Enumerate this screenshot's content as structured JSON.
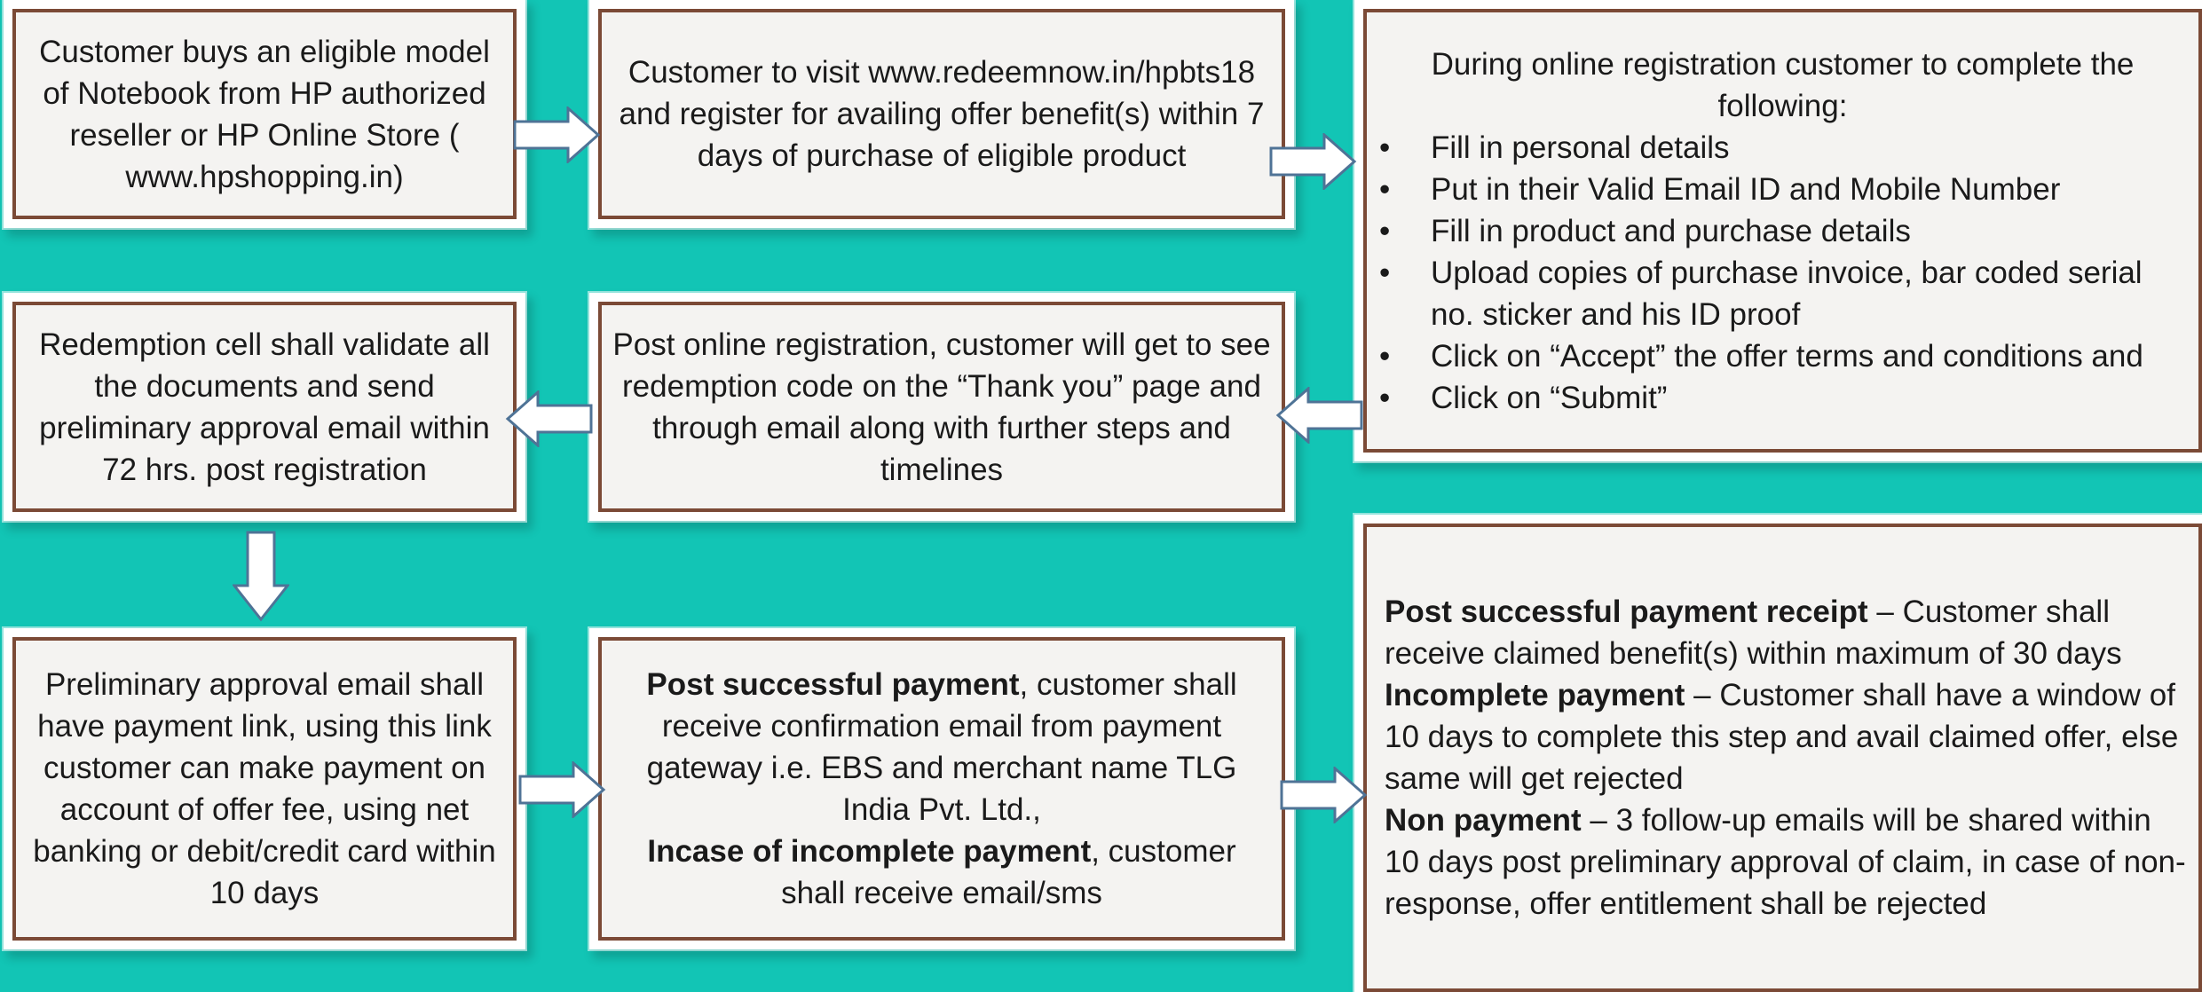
{
  "boxes": {
    "b1": "Customer buys an eligible model of Notebook from HP authorized reseller or HP Online Store ( www.hpshopping.in)",
    "b2": "Customer to visit www.redeemnow.in/hpbts18 and register for availing offer benefit(s) within 7 days of purchase of eligible product",
    "b3": {
      "heading": "During online registration customer  to complete the following:",
      "items": [
        "Fill in personal details",
        "Put in their Valid Email ID and Mobile Number",
        "Fill in product and purchase details",
        "Upload copies of purchase invoice, bar coded serial no. sticker and his ID proof",
        "Click on “Accept” the offer terms and conditions and",
        "Click on “Submit”"
      ]
    },
    "b4": "Redemption cell shall validate all the documents and send preliminary approval email within 72 hrs. post registration",
    "b5": "Post online registration, customer will get to see redemption code on the “Thank you” page and through email along with further steps and timelines",
    "b6": "Preliminary approval email shall have payment link, using this link customer can make payment on account of offer fee, using net banking or debit/credit card within 10 days",
    "b7": {
      "p1_bold": "Post successful payment",
      "p1_rest": ", customer shall receive confirmation email from payment gateway i.e. EBS and merchant name TLG India Pvt. Ltd.,",
      "p2_bold": "Incase of incomplete payment",
      "p2_rest": ", customer shall receive email/sms"
    },
    "b8": {
      "s1_bold": "Post successful payment receipt",
      "s1_rest": " – Customer shall receive claimed benefit(s) within maximum of 30 days",
      "s2_bold": "Incomplete payment",
      "s2_rest": " – Customer shall have  a window of 10 days to complete this step and avail claimed offer, else same will get rejected",
      "s3_bold": "Non payment",
      "s3_rest": " – 3 follow-up emails will be shared within 10 days post preliminary approval of claim, in case of non-response, offer entitlement shall be rejected"
    }
  },
  "colors": {
    "background": "#12C5B5",
    "box_fill": "#F4F3F1",
    "box_border": "#7B4A36",
    "arrow_fill": "#FFFFFF",
    "arrow_stroke": "#4F7396"
  }
}
